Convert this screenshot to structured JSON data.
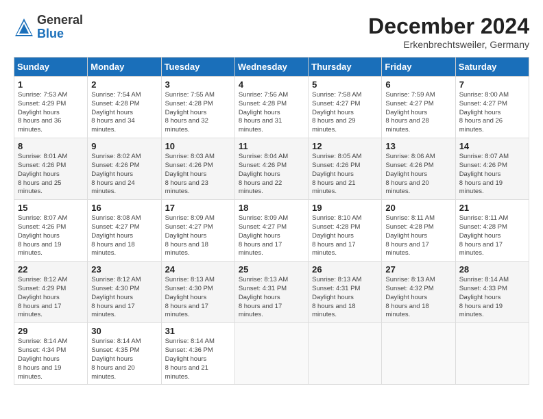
{
  "logo": {
    "general": "General",
    "blue": "Blue"
  },
  "title": "December 2024",
  "location": "Erkenbrechtsweiler, Germany",
  "days_header": [
    "Sunday",
    "Monday",
    "Tuesday",
    "Wednesday",
    "Thursday",
    "Friday",
    "Saturday"
  ],
  "weeks": [
    [
      {
        "day": "1",
        "sunrise": "7:53 AM",
        "sunset": "4:29 PM",
        "daylight": "8 hours and 36 minutes."
      },
      {
        "day": "2",
        "sunrise": "7:54 AM",
        "sunset": "4:28 PM",
        "daylight": "8 hours and 34 minutes."
      },
      {
        "day": "3",
        "sunrise": "7:55 AM",
        "sunset": "4:28 PM",
        "daylight": "8 hours and 32 minutes."
      },
      {
        "day": "4",
        "sunrise": "7:56 AM",
        "sunset": "4:28 PM",
        "daylight": "8 hours and 31 minutes."
      },
      {
        "day": "5",
        "sunrise": "7:58 AM",
        "sunset": "4:27 PM",
        "daylight": "8 hours and 29 minutes."
      },
      {
        "day": "6",
        "sunrise": "7:59 AM",
        "sunset": "4:27 PM",
        "daylight": "8 hours and 28 minutes."
      },
      {
        "day": "7",
        "sunrise": "8:00 AM",
        "sunset": "4:27 PM",
        "daylight": "8 hours and 26 minutes."
      }
    ],
    [
      {
        "day": "8",
        "sunrise": "8:01 AM",
        "sunset": "4:26 PM",
        "daylight": "8 hours and 25 minutes."
      },
      {
        "day": "9",
        "sunrise": "8:02 AM",
        "sunset": "4:26 PM",
        "daylight": "8 hours and 24 minutes."
      },
      {
        "day": "10",
        "sunrise": "8:03 AM",
        "sunset": "4:26 PM",
        "daylight": "8 hours and 23 minutes."
      },
      {
        "day": "11",
        "sunrise": "8:04 AM",
        "sunset": "4:26 PM",
        "daylight": "8 hours and 22 minutes."
      },
      {
        "day": "12",
        "sunrise": "8:05 AM",
        "sunset": "4:26 PM",
        "daylight": "8 hours and 21 minutes."
      },
      {
        "day": "13",
        "sunrise": "8:06 AM",
        "sunset": "4:26 PM",
        "daylight": "8 hours and 20 minutes."
      },
      {
        "day": "14",
        "sunrise": "8:07 AM",
        "sunset": "4:26 PM",
        "daylight": "8 hours and 19 minutes."
      }
    ],
    [
      {
        "day": "15",
        "sunrise": "8:07 AM",
        "sunset": "4:26 PM",
        "daylight": "8 hours and 19 minutes."
      },
      {
        "day": "16",
        "sunrise": "8:08 AM",
        "sunset": "4:27 PM",
        "daylight": "8 hours and 18 minutes."
      },
      {
        "day": "17",
        "sunrise": "8:09 AM",
        "sunset": "4:27 PM",
        "daylight": "8 hours and 18 minutes."
      },
      {
        "day": "18",
        "sunrise": "8:09 AM",
        "sunset": "4:27 PM",
        "daylight": "8 hours and 17 minutes."
      },
      {
        "day": "19",
        "sunrise": "8:10 AM",
        "sunset": "4:28 PM",
        "daylight": "8 hours and 17 minutes."
      },
      {
        "day": "20",
        "sunrise": "8:11 AM",
        "sunset": "4:28 PM",
        "daylight": "8 hours and 17 minutes."
      },
      {
        "day": "21",
        "sunrise": "8:11 AM",
        "sunset": "4:28 PM",
        "daylight": "8 hours and 17 minutes."
      }
    ],
    [
      {
        "day": "22",
        "sunrise": "8:12 AM",
        "sunset": "4:29 PM",
        "daylight": "8 hours and 17 minutes."
      },
      {
        "day": "23",
        "sunrise": "8:12 AM",
        "sunset": "4:30 PM",
        "daylight": "8 hours and 17 minutes."
      },
      {
        "day": "24",
        "sunrise": "8:13 AM",
        "sunset": "4:30 PM",
        "daylight": "8 hours and 17 minutes."
      },
      {
        "day": "25",
        "sunrise": "8:13 AM",
        "sunset": "4:31 PM",
        "daylight": "8 hours and 17 minutes."
      },
      {
        "day": "26",
        "sunrise": "8:13 AM",
        "sunset": "4:31 PM",
        "daylight": "8 hours and 18 minutes."
      },
      {
        "day": "27",
        "sunrise": "8:13 AM",
        "sunset": "4:32 PM",
        "daylight": "8 hours and 18 minutes."
      },
      {
        "day": "28",
        "sunrise": "8:14 AM",
        "sunset": "4:33 PM",
        "daylight": "8 hours and 19 minutes."
      }
    ],
    [
      {
        "day": "29",
        "sunrise": "8:14 AM",
        "sunset": "4:34 PM",
        "daylight": "8 hours and 19 minutes."
      },
      {
        "day": "30",
        "sunrise": "8:14 AM",
        "sunset": "4:35 PM",
        "daylight": "8 hours and 20 minutes."
      },
      {
        "day": "31",
        "sunrise": "8:14 AM",
        "sunset": "4:36 PM",
        "daylight": "8 hours and 21 minutes."
      },
      null,
      null,
      null,
      null
    ]
  ],
  "labels": {
    "sunrise": "Sunrise:",
    "sunset": "Sunset:",
    "daylight": "Daylight hours"
  }
}
